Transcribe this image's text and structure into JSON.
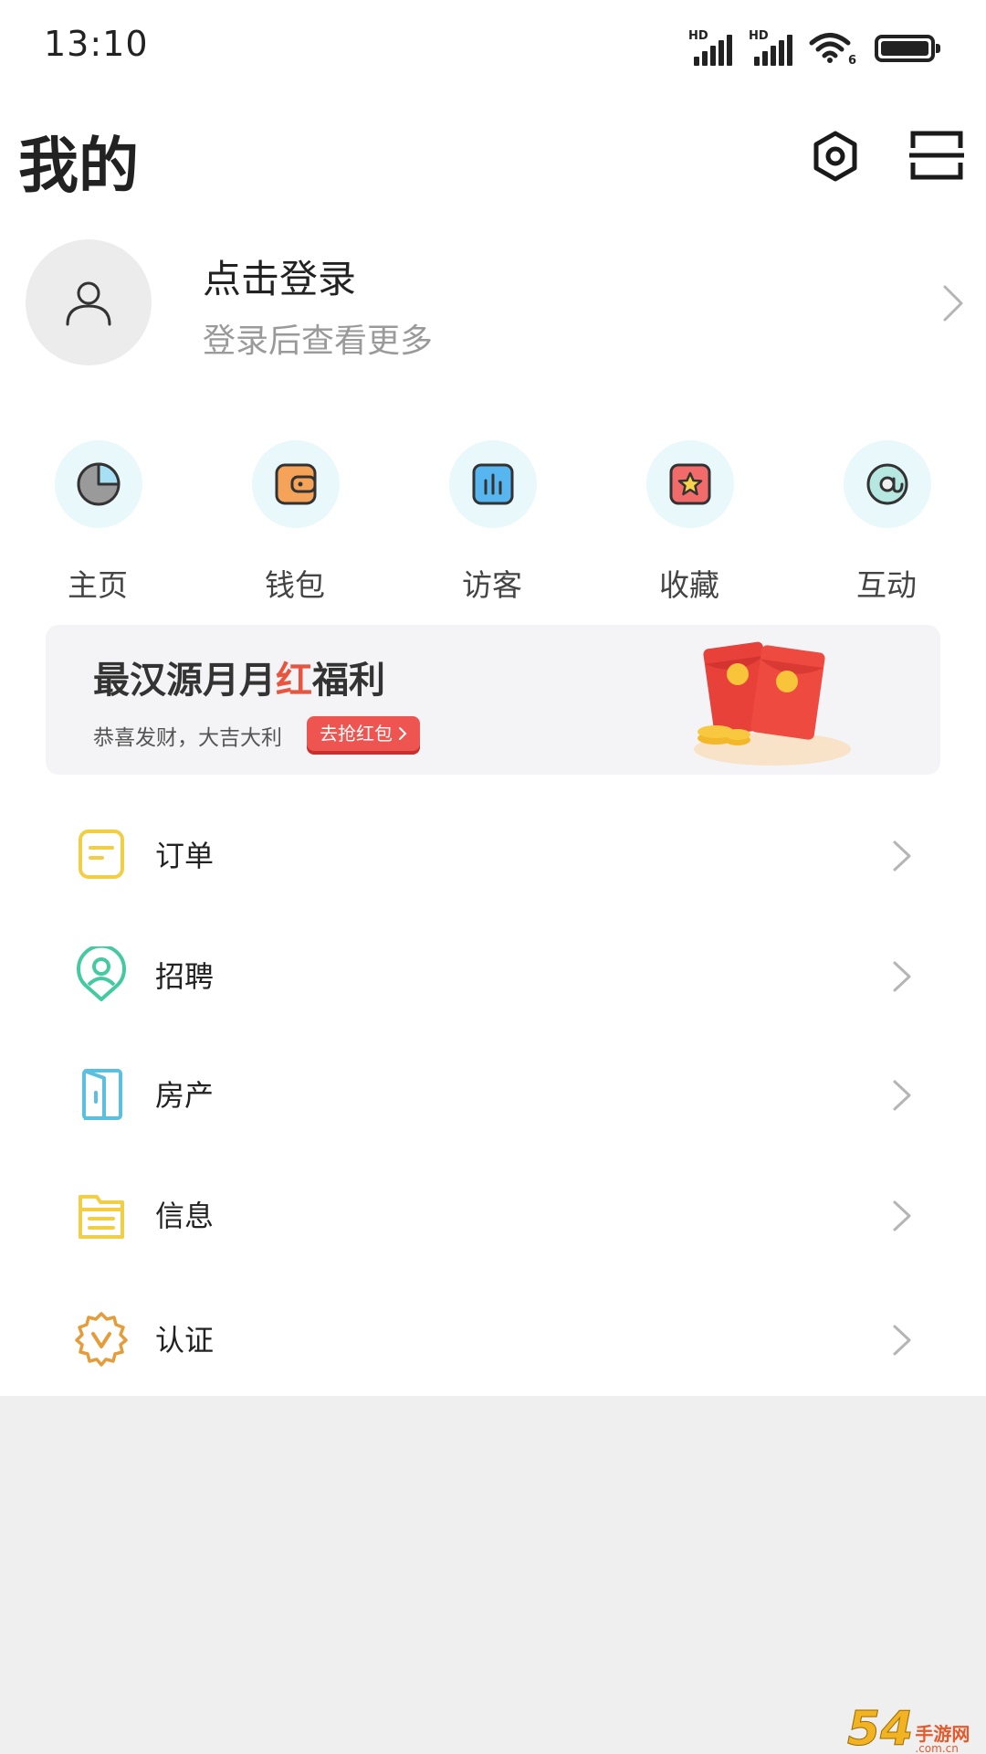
{
  "status_bar": {
    "time": "13:10",
    "signal1_label": "HD",
    "signal2_label": "HD",
    "wifi_label": "6"
  },
  "header": {
    "title": "我的",
    "settings_icon": "gear-icon",
    "scan_icon": "scan-icon"
  },
  "profile": {
    "login_title": "点击登录",
    "login_subtitle": "登录后查看更多",
    "avatar_icon": "user-icon"
  },
  "quick_actions": [
    {
      "label": "主页",
      "icon": "pie-chart-icon"
    },
    {
      "label": "钱包",
      "icon": "wallet-icon"
    },
    {
      "label": "访客",
      "icon": "bar-chart-icon"
    },
    {
      "label": "收藏",
      "icon": "star-icon"
    },
    {
      "label": "互动",
      "icon": "at-icon"
    }
  ],
  "banner": {
    "title_prefix": "最汉源月月",
    "title_highlight": "红",
    "title_suffix": "福利",
    "subtitle": "恭喜发财，大吉大利",
    "button_label": "去抢红包",
    "highlight_color": "#e8543e"
  },
  "menu": [
    {
      "label": "订单",
      "icon": "order-icon"
    },
    {
      "label": "招聘",
      "icon": "location-person-icon"
    },
    {
      "label": "房产",
      "icon": "door-icon"
    },
    {
      "label": "信息",
      "icon": "folder-icon"
    },
    {
      "label": "认证",
      "icon": "verified-badge-icon"
    }
  ],
  "watermark": {
    "number": "54",
    "cn": "手游网",
    "domain": ".com.cn"
  }
}
